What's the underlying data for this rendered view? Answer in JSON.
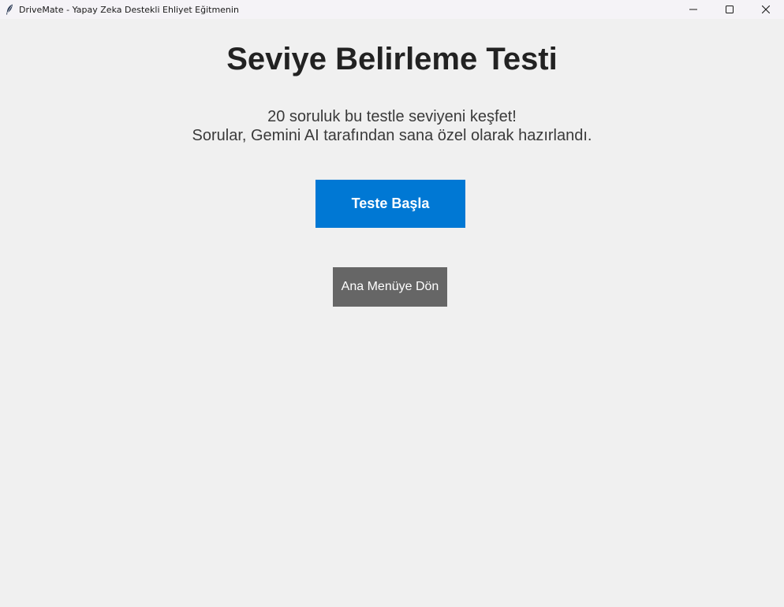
{
  "window": {
    "title": "DriveMate - Yapay Zeka Destekli Ehliyet Eğitmenin",
    "app_icon": "feather-icon",
    "controls": [
      "minimize-icon",
      "maximize-icon",
      "close-icon"
    ]
  },
  "main": {
    "title": "Seviye Belirleme Testi",
    "subtitle_line1": "20 soruluk bu testle seviyeni keşfet!",
    "subtitle_line2": "Sorular, Gemini AI tarafından sana özel olarak hazırlandı.",
    "start_button_label": "Teste Başla",
    "menu_button_label": "Ana Menüye Dön"
  },
  "colors": {
    "background": "#f0f0f0",
    "primary_button": "#0078d4",
    "secondary_button": "#666666",
    "title_text": "#222222"
  }
}
